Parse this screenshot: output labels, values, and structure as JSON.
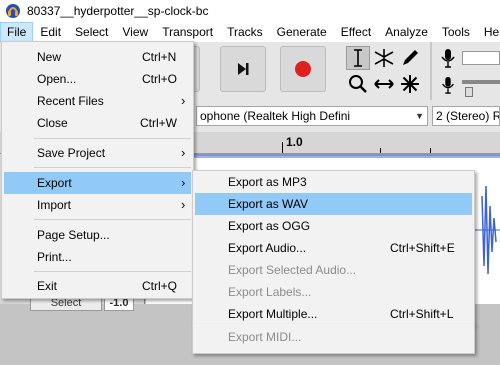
{
  "window": {
    "title": "80337__hyderpotter__sp-clock-bc"
  },
  "menubar": {
    "items": [
      "File",
      "Edit",
      "Select",
      "View",
      "Transport",
      "Tracks",
      "Generate",
      "Effect",
      "Analyze",
      "Tools",
      "Help"
    ]
  },
  "devicebar": {
    "input_device": "ophone (Realtek High Defini",
    "channels": "2 (Stereo) Re"
  },
  "ruler": {
    "label": "1.0"
  },
  "track": {
    "select_label": "Select",
    "gain_value": "-1.0"
  },
  "file_menu": {
    "items": [
      {
        "label": "New",
        "shortcut": "Ctrl+N"
      },
      {
        "label": "Open...",
        "shortcut": "Ctrl+O"
      },
      {
        "label": "Recent Files",
        "submenu": true
      },
      {
        "label": "Close",
        "shortcut": "Ctrl+W"
      },
      {
        "label": "Save Project",
        "submenu": true
      },
      {
        "label": "Export",
        "submenu": true
      },
      {
        "label": "Import",
        "submenu": true
      },
      {
        "label": "Page Setup..."
      },
      {
        "label": "Print..."
      },
      {
        "label": "Exit",
        "shortcut": "Ctrl+Q"
      }
    ],
    "arrow": "›"
  },
  "export_menu": {
    "items": [
      {
        "label": "Export as MP3"
      },
      {
        "label": "Export as WAV"
      },
      {
        "label": "Export as OGG"
      },
      {
        "label": "Export Audio...",
        "shortcut": "Ctrl+Shift+E"
      },
      {
        "label": "Export Selected Audio..."
      },
      {
        "label": "Export Labels..."
      },
      {
        "label": "Export Multiple...",
        "shortcut": "Ctrl+Shift+L"
      },
      {
        "label": "Export MIDI..."
      }
    ]
  },
  "colors": {
    "highlight": "#91c9f7",
    "menu_active": "#cce8ff",
    "waveform": "#3c64d2",
    "record": "#e02020"
  },
  "icons": [
    "audacity-app-icon",
    "skip-to-end-icon",
    "record-icon",
    "selection-tool-icon",
    "envelope-tool-icon",
    "draw-tool-icon",
    "zoom-tool-icon",
    "timeshift-tool-icon",
    "multi-tool-icon",
    "microphone-icon"
  ]
}
